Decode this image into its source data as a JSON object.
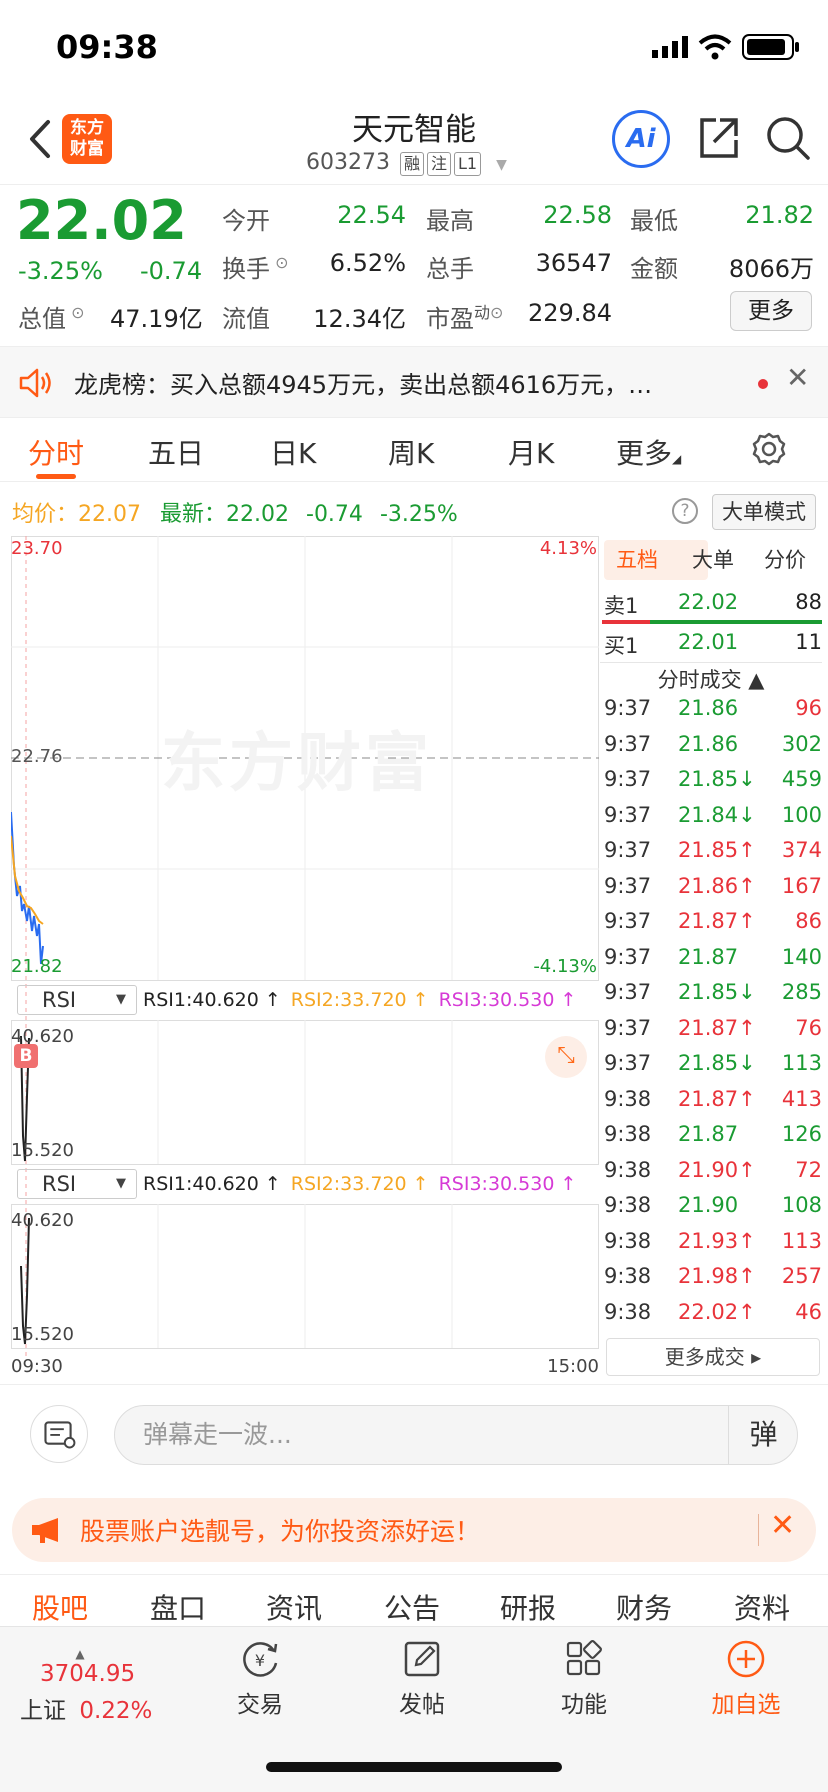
{
  "status_bar": {
    "time": "09:38"
  },
  "header": {
    "title": "天元智能",
    "code": "603273",
    "tags": [
      "融",
      "注",
      "L1"
    ],
    "logo_line1": "东方",
    "logo_line2": "财富",
    "ai_label": "Ai"
  },
  "quote": {
    "price": "22.02",
    "change_pct": "-3.25%",
    "change_val": "-0.74",
    "open_label": "今开",
    "open": "22.54",
    "high_label": "最高",
    "high": "22.58",
    "low_label": "最低",
    "low": "21.82",
    "turnover_label": "换手",
    "turnover": "6.52%",
    "volume_label": "总手",
    "volume": "36547",
    "amount_label": "金额",
    "amount": "8066万",
    "mktcap_label": "总值",
    "mktcap": "47.19亿",
    "float_label": "流值",
    "float_cap": "12.34亿",
    "pe_label": "市盈",
    "pe_sup": "动",
    "pe": "229.84",
    "more_label": "更多"
  },
  "banner": {
    "text": "龙虎榜：买入总额4945万元，卖出总额4616万元，…"
  },
  "tabs": [
    "分时",
    "五日",
    "日K",
    "周K",
    "月K",
    "更多"
  ],
  "info": {
    "avg_label": "均价：",
    "avg": "22.07",
    "latest_label": "最新：",
    "latest": "22.02",
    "chg": "-0.74",
    "pct": "-3.25%",
    "help": "?",
    "mode_label": "大单模式"
  },
  "chart": {
    "y_top": "23.70",
    "y_mid": "22.76",
    "y_bot": "21.82",
    "pct_top": "4.13%",
    "pct_bot": "-4.13%",
    "watermark": "东方财富",
    "time_start": "09:30",
    "time_end": "15:00",
    "marker": "B",
    "indicator": {
      "name": "RSI",
      "rsi1": "RSI1:40.620 ↑",
      "rsi2": "RSI2:33.720 ↑",
      "rsi3": "RSI3:30.530 ↑",
      "top": "40.620",
      "bottom": "15.520"
    }
  },
  "book": {
    "tabs": [
      "五档",
      "大单",
      "分价"
    ],
    "sell1_label": "卖1",
    "sell1_price": "22.02",
    "sell1_vol": "88",
    "buy1_label": "买1",
    "buy1_price": "22.01",
    "buy1_vol": "11",
    "ticks_header": "分时成交 ▲",
    "ticks": [
      {
        "t": "9:37",
        "p": "21.86",
        "v": "96",
        "dir": "",
        "c": "red"
      },
      {
        "t": "9:37",
        "p": "21.86",
        "v": "302",
        "dir": "",
        "c": "green"
      },
      {
        "t": "9:37",
        "p": "21.85↓",
        "v": "459",
        "dir": "down",
        "c": "green"
      },
      {
        "t": "9:37",
        "p": "21.84↓",
        "v": "100",
        "dir": "down",
        "c": "green"
      },
      {
        "t": "9:37",
        "p": "21.85↑",
        "v": "374",
        "dir": "up",
        "c": "red"
      },
      {
        "t": "9:37",
        "p": "21.86↑",
        "v": "167",
        "dir": "up",
        "c": "red"
      },
      {
        "t": "9:37",
        "p": "21.87↑",
        "v": "86",
        "dir": "up",
        "c": "red"
      },
      {
        "t": "9:37",
        "p": "21.87",
        "v": "140",
        "dir": "",
        "c": "green"
      },
      {
        "t": "9:37",
        "p": "21.85↓",
        "v": "285",
        "dir": "down",
        "c": "green"
      },
      {
        "t": "9:37",
        "p": "21.87↑",
        "v": "76",
        "dir": "up",
        "c": "red"
      },
      {
        "t": "9:37",
        "p": "21.85↓",
        "v": "113",
        "dir": "down",
        "c": "green"
      },
      {
        "t": "9:38",
        "p": "21.87↑",
        "v": "413",
        "dir": "up",
        "c": "red"
      },
      {
        "t": "9:38",
        "p": "21.87",
        "v": "126",
        "dir": "",
        "c": "green"
      },
      {
        "t": "9:38",
        "p": "21.90↑",
        "v": "72",
        "dir": "up",
        "c": "red"
      },
      {
        "t": "9:38",
        "p": "21.90",
        "v": "108",
        "dir": "",
        "c": "green"
      },
      {
        "t": "9:38",
        "p": "21.93↑",
        "v": "113",
        "dir": "up",
        "c": "red"
      },
      {
        "t": "9:38",
        "p": "21.98↑",
        "v": "257",
        "dir": "up",
        "c": "red"
      },
      {
        "t": "9:38",
        "p": "22.02↑",
        "v": "46",
        "dir": "up",
        "c": "red"
      }
    ],
    "more_ticks": "更多成交 ▸"
  },
  "comment": {
    "placeholder": "弹幕走一波...",
    "danmu": "弹"
  },
  "promo": {
    "text": "股票账户选靓号，为你投资添好运！"
  },
  "section_tabs": [
    "股吧",
    "盘口",
    "资讯",
    "公告",
    "研报",
    "财务",
    "资料"
  ],
  "bottom_nav": {
    "index_value": "3704.95",
    "index_name": "上证",
    "index_pct": "0.22%",
    "items": [
      "交易",
      "发帖",
      "功能",
      "加自选"
    ]
  },
  "colors": {
    "up": "#e8333a",
    "down": "#1a9b32",
    "accent": "#ff5a14",
    "avg": "#f5a623",
    "rsi3": "#d63ad6"
  }
}
